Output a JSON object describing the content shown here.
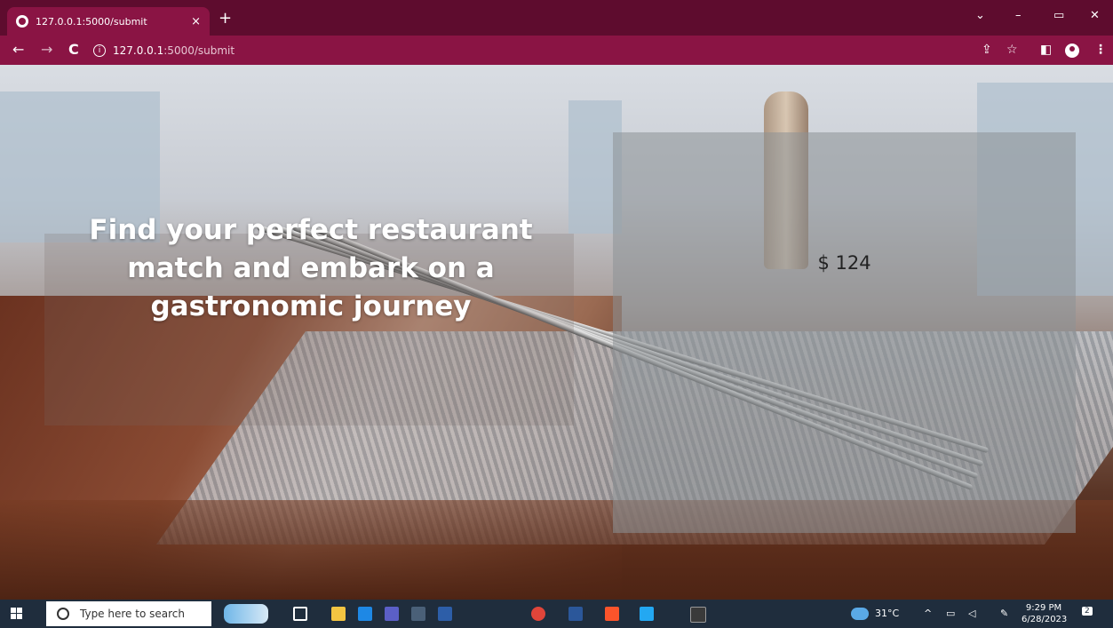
{
  "browser": {
    "tab_title": "127.0.0.1:5000/submit",
    "tab_close": "×",
    "new_tab": "+",
    "url_host": "127.0.0.1",
    "url_path": ":5000/submit",
    "info_glyph": "i",
    "back": "←",
    "forward": "→",
    "reload": "C",
    "window_controls": {
      "tabsearch": "⌄",
      "minimize": "–",
      "restore": "▭",
      "close": "✕"
    },
    "toolbar_icons": {
      "share": "⇪",
      "bookmark": "☆",
      "sidepanel": "◧",
      "menu": "⋮"
    }
  },
  "page": {
    "headline": "Find your perfect restaurant match and embark on a gastronomic journey",
    "price": "$ 124"
  },
  "taskbar": {
    "search_placeholder": "Type here to search",
    "weather": "31°C",
    "time": "9:29 PM",
    "date": "6/28/2023",
    "notifications_count": "2",
    "colors": {
      "bar": "#1f2d3d",
      "file_explorer": "#f4c542",
      "mail": "#1e88e5",
      "teams": "#5b5fc7",
      "powershell": "#2d5ea8",
      "chrome": "#e0453a",
      "word": "#2b579a",
      "brave": "#fb542b",
      "vscode": "#23a8f2",
      "terminal": "#3a3a3a"
    }
  },
  "theme": {
    "chrome_dark": "#5e0c2e",
    "chrome_light": "#8a1444"
  }
}
